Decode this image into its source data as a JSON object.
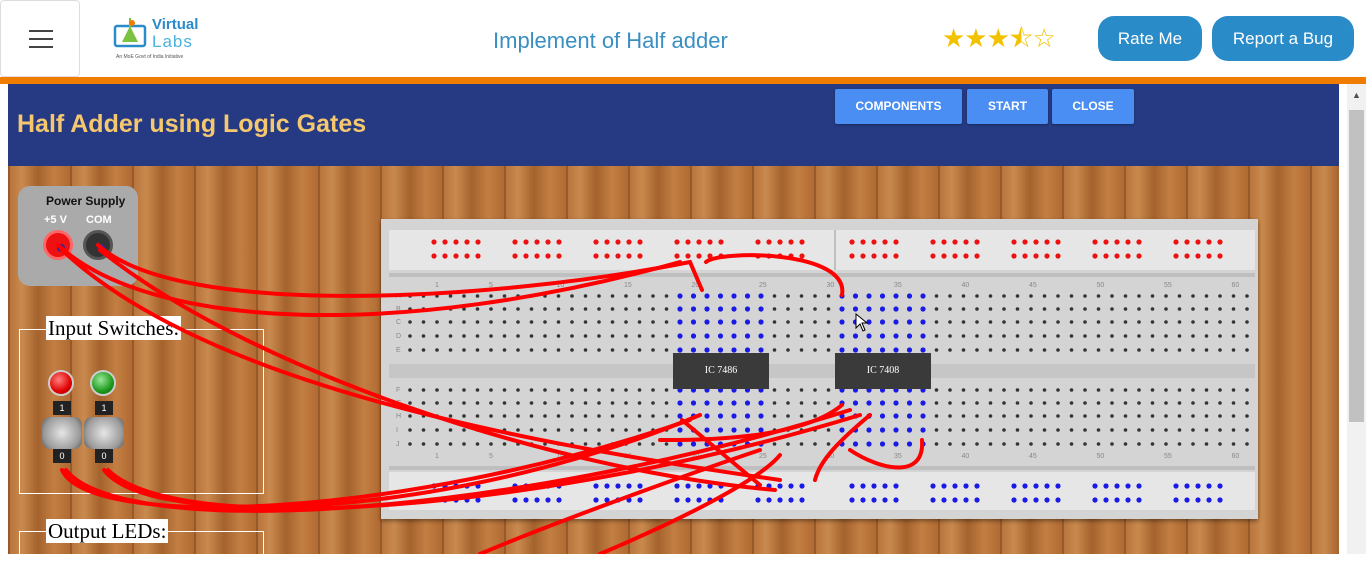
{
  "header": {
    "logo_line1": "Virtual",
    "logo_line2": "Labs",
    "logo_tagline": "An MoE Govt of India Initiative",
    "title": "Implement of Half adder",
    "rating": 3.5,
    "rating_max": 5,
    "rating_glyphs": "★★★⯪☆",
    "rate_button": "Rate Me",
    "bug_button": "Report a Bug",
    "accent_orange": "#f07c00",
    "accent_blue": "#2a8bc9"
  },
  "simulation": {
    "title": "Half Adder using Logic Gates",
    "buttons": [
      "COMPONENTS",
      "START",
      "CLOSE"
    ],
    "header_color": "#253a82"
  },
  "power_supply": {
    "title": "Power Supply",
    "positive_label": "+5 V",
    "common_label": "COM"
  },
  "input_switches": {
    "title": "Input Switches:",
    "switches": [
      {
        "top": "1",
        "bottom": "0",
        "led": "red"
      },
      {
        "top": "1",
        "bottom": "0",
        "led": "green"
      }
    ]
  },
  "output_leds": {
    "title": "Output LEDs:"
  },
  "breadboard": {
    "ics": [
      {
        "label": "IC 7486"
      },
      {
        "label": "IC 7408"
      }
    ],
    "column_numbers": [
      "1",
      "5",
      "10",
      "15",
      "20",
      "25",
      "30",
      "35",
      "40",
      "45",
      "50",
      "55",
      "60"
    ],
    "row_letters_top": [
      "A",
      "B",
      "C",
      "D",
      "E"
    ],
    "row_letters_bottom": [
      "F",
      "G",
      "H",
      "I",
      "J"
    ]
  }
}
